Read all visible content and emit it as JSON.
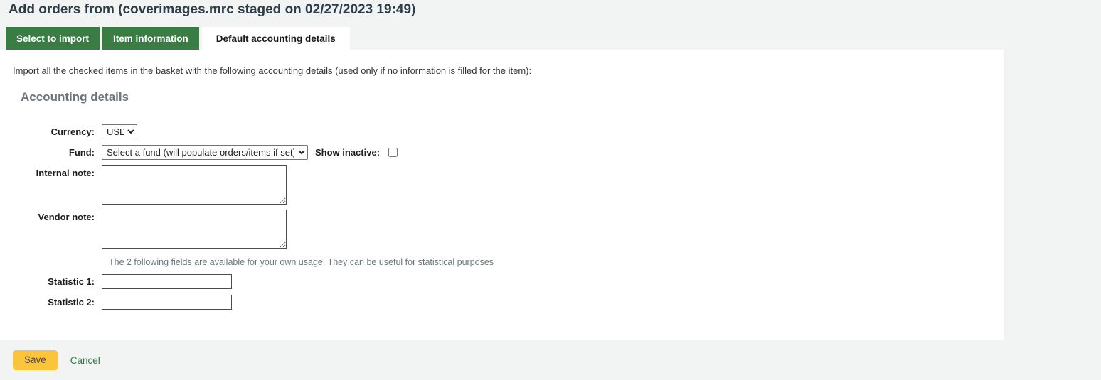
{
  "page": {
    "title": "Add orders from (coverimages.mrc staged on 02/27/2023 19:49)"
  },
  "tabs": [
    {
      "label": "Select to import",
      "active": false
    },
    {
      "label": "Item information",
      "active": false
    },
    {
      "label": "Default accounting details",
      "active": true
    }
  ],
  "content": {
    "intro": "Import all the checked items in the basket with the following accounting details (used only if no information is filled for the item):",
    "legend": "Accounting details",
    "hint": "The 2 following fields are available for your own usage. They can be useful for statistical purposes"
  },
  "form": {
    "currency": {
      "label": "Currency:",
      "value": "USD",
      "options": [
        "USD"
      ]
    },
    "fund": {
      "label": "Fund:",
      "value": "Select a fund (will populate orders/items if set)",
      "options": [
        "Select a fund (will populate orders/items if set)"
      ]
    },
    "show_inactive": {
      "label": "Show inactive:",
      "checked": false
    },
    "internal_note": {
      "label": "Internal note:",
      "value": ""
    },
    "vendor_note": {
      "label": "Vendor note:",
      "value": ""
    },
    "statistic_1": {
      "label": "Statistic 1:",
      "value": ""
    },
    "statistic_2": {
      "label": "Statistic 2:",
      "value": ""
    }
  },
  "actions": {
    "save_label": "Save",
    "cancel_label": "Cancel"
  },
  "colors": {
    "tab_green": "#3a7d44",
    "save_yellow": "#fcc43c",
    "link_green": "#2d7a3e",
    "page_background": "#f2f4f4",
    "title_color": "#2d3c49",
    "legend_gray": "#6c757d"
  }
}
